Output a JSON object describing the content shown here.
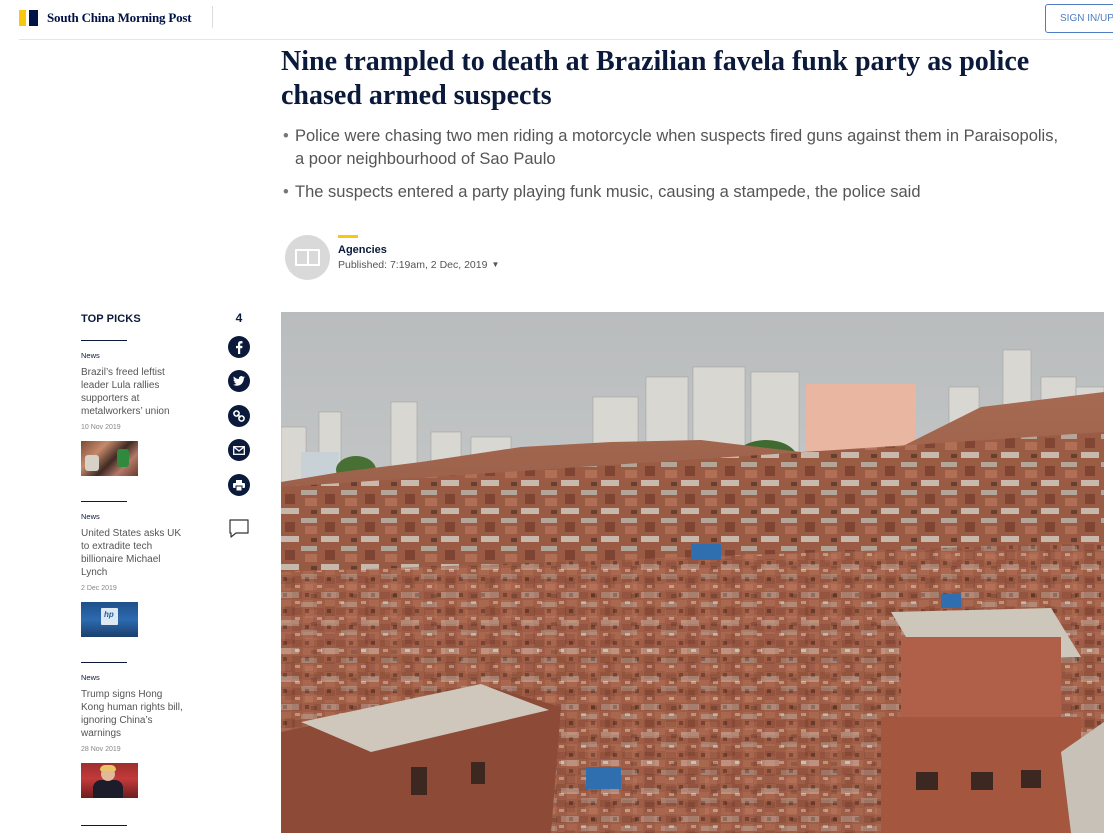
{
  "site": {
    "name": "South China Morning Post",
    "signin_label": "SIGN IN/UP",
    "colors": {
      "brand_navy": "#001246",
      "brand_yellow": "#f9c80e",
      "signin_blue": "#4e7dc2"
    }
  },
  "article": {
    "headline": "Nine trampled to death at Brazilian favela funk party as police chased armed suspects",
    "summary": [
      "Police were chasing two men riding a motorcycle when suspects fired guns against them in Paraisopolis, a poor neighbourhood of Sao Paulo",
      "The suspects entered a party playing funk music, causing a stampede, the police said"
    ],
    "author": "Agencies",
    "published": "Published: 7:19am, 2 Dec, 2019"
  },
  "top_picks": {
    "title": "TOP PICKS",
    "items": [
      {
        "category": "News",
        "title": "Brazil’s freed leftist leader Lula rallies supporters at metalworkers’ union",
        "date": "10 Nov 2019"
      },
      {
        "category": "News",
        "title": "United States asks UK to extradite tech billionaire Michael Lynch",
        "date": "2 Dec 2019"
      },
      {
        "category": "News",
        "title": "Trump signs Hong Kong human rights bill, ignoring China’s warnings",
        "date": "28 Nov 2019"
      }
    ]
  },
  "share": {
    "count": "4",
    "icons": [
      "facebook-icon",
      "twitter-icon",
      "link-icon",
      "email-icon",
      "print-icon",
      "comment-icon"
    ]
  }
}
